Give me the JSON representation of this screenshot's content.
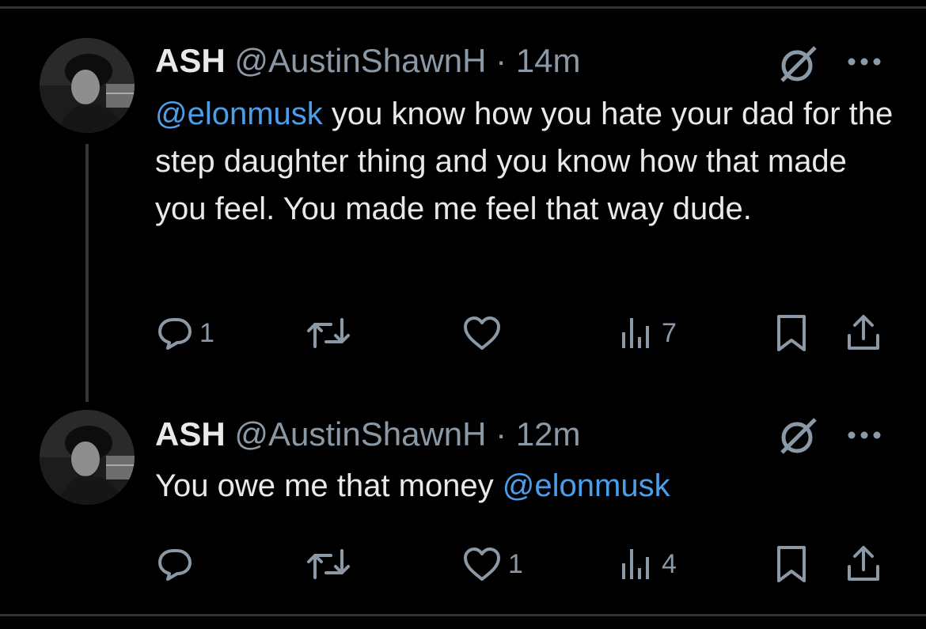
{
  "tweets": [
    {
      "name": "ASH",
      "handle": "@AustinShawnH",
      "separator": "·",
      "time": "14m",
      "text_parts": [
        {
          "type": "mention",
          "text": "@elonmusk"
        },
        {
          "type": "text",
          "text": " you know how you hate your dad for the step daughter thing and you know how that made you feel. You made me feel that way dude."
        }
      ],
      "actions": {
        "reply_count": "1",
        "retweet_count": "",
        "like_count": "",
        "views_count": "7"
      },
      "icons": [
        "grok-icon",
        "more-icon",
        "reply-icon",
        "retweet-icon",
        "like-icon",
        "views-icon",
        "bookmark-icon",
        "share-icon"
      ]
    },
    {
      "name": "ASH",
      "handle": "@AustinShawnH",
      "separator": "·",
      "time": "12m",
      "text_parts": [
        {
          "type": "text",
          "text": "You owe me that money "
        },
        {
          "type": "mention",
          "text": "@elonmusk"
        }
      ],
      "actions": {
        "reply_count": "",
        "retweet_count": "",
        "like_count": "1",
        "views_count": "4"
      },
      "icons": [
        "grok-icon",
        "more-icon",
        "reply-icon",
        "retweet-icon",
        "like-icon",
        "views-icon",
        "bookmark-icon",
        "share-icon"
      ]
    }
  ],
  "colors": {
    "background": "#000000",
    "text": "#e7e9ea",
    "secondary": "#8b98a5",
    "mention": "#4c9eeb",
    "divider": "#2f3336"
  }
}
